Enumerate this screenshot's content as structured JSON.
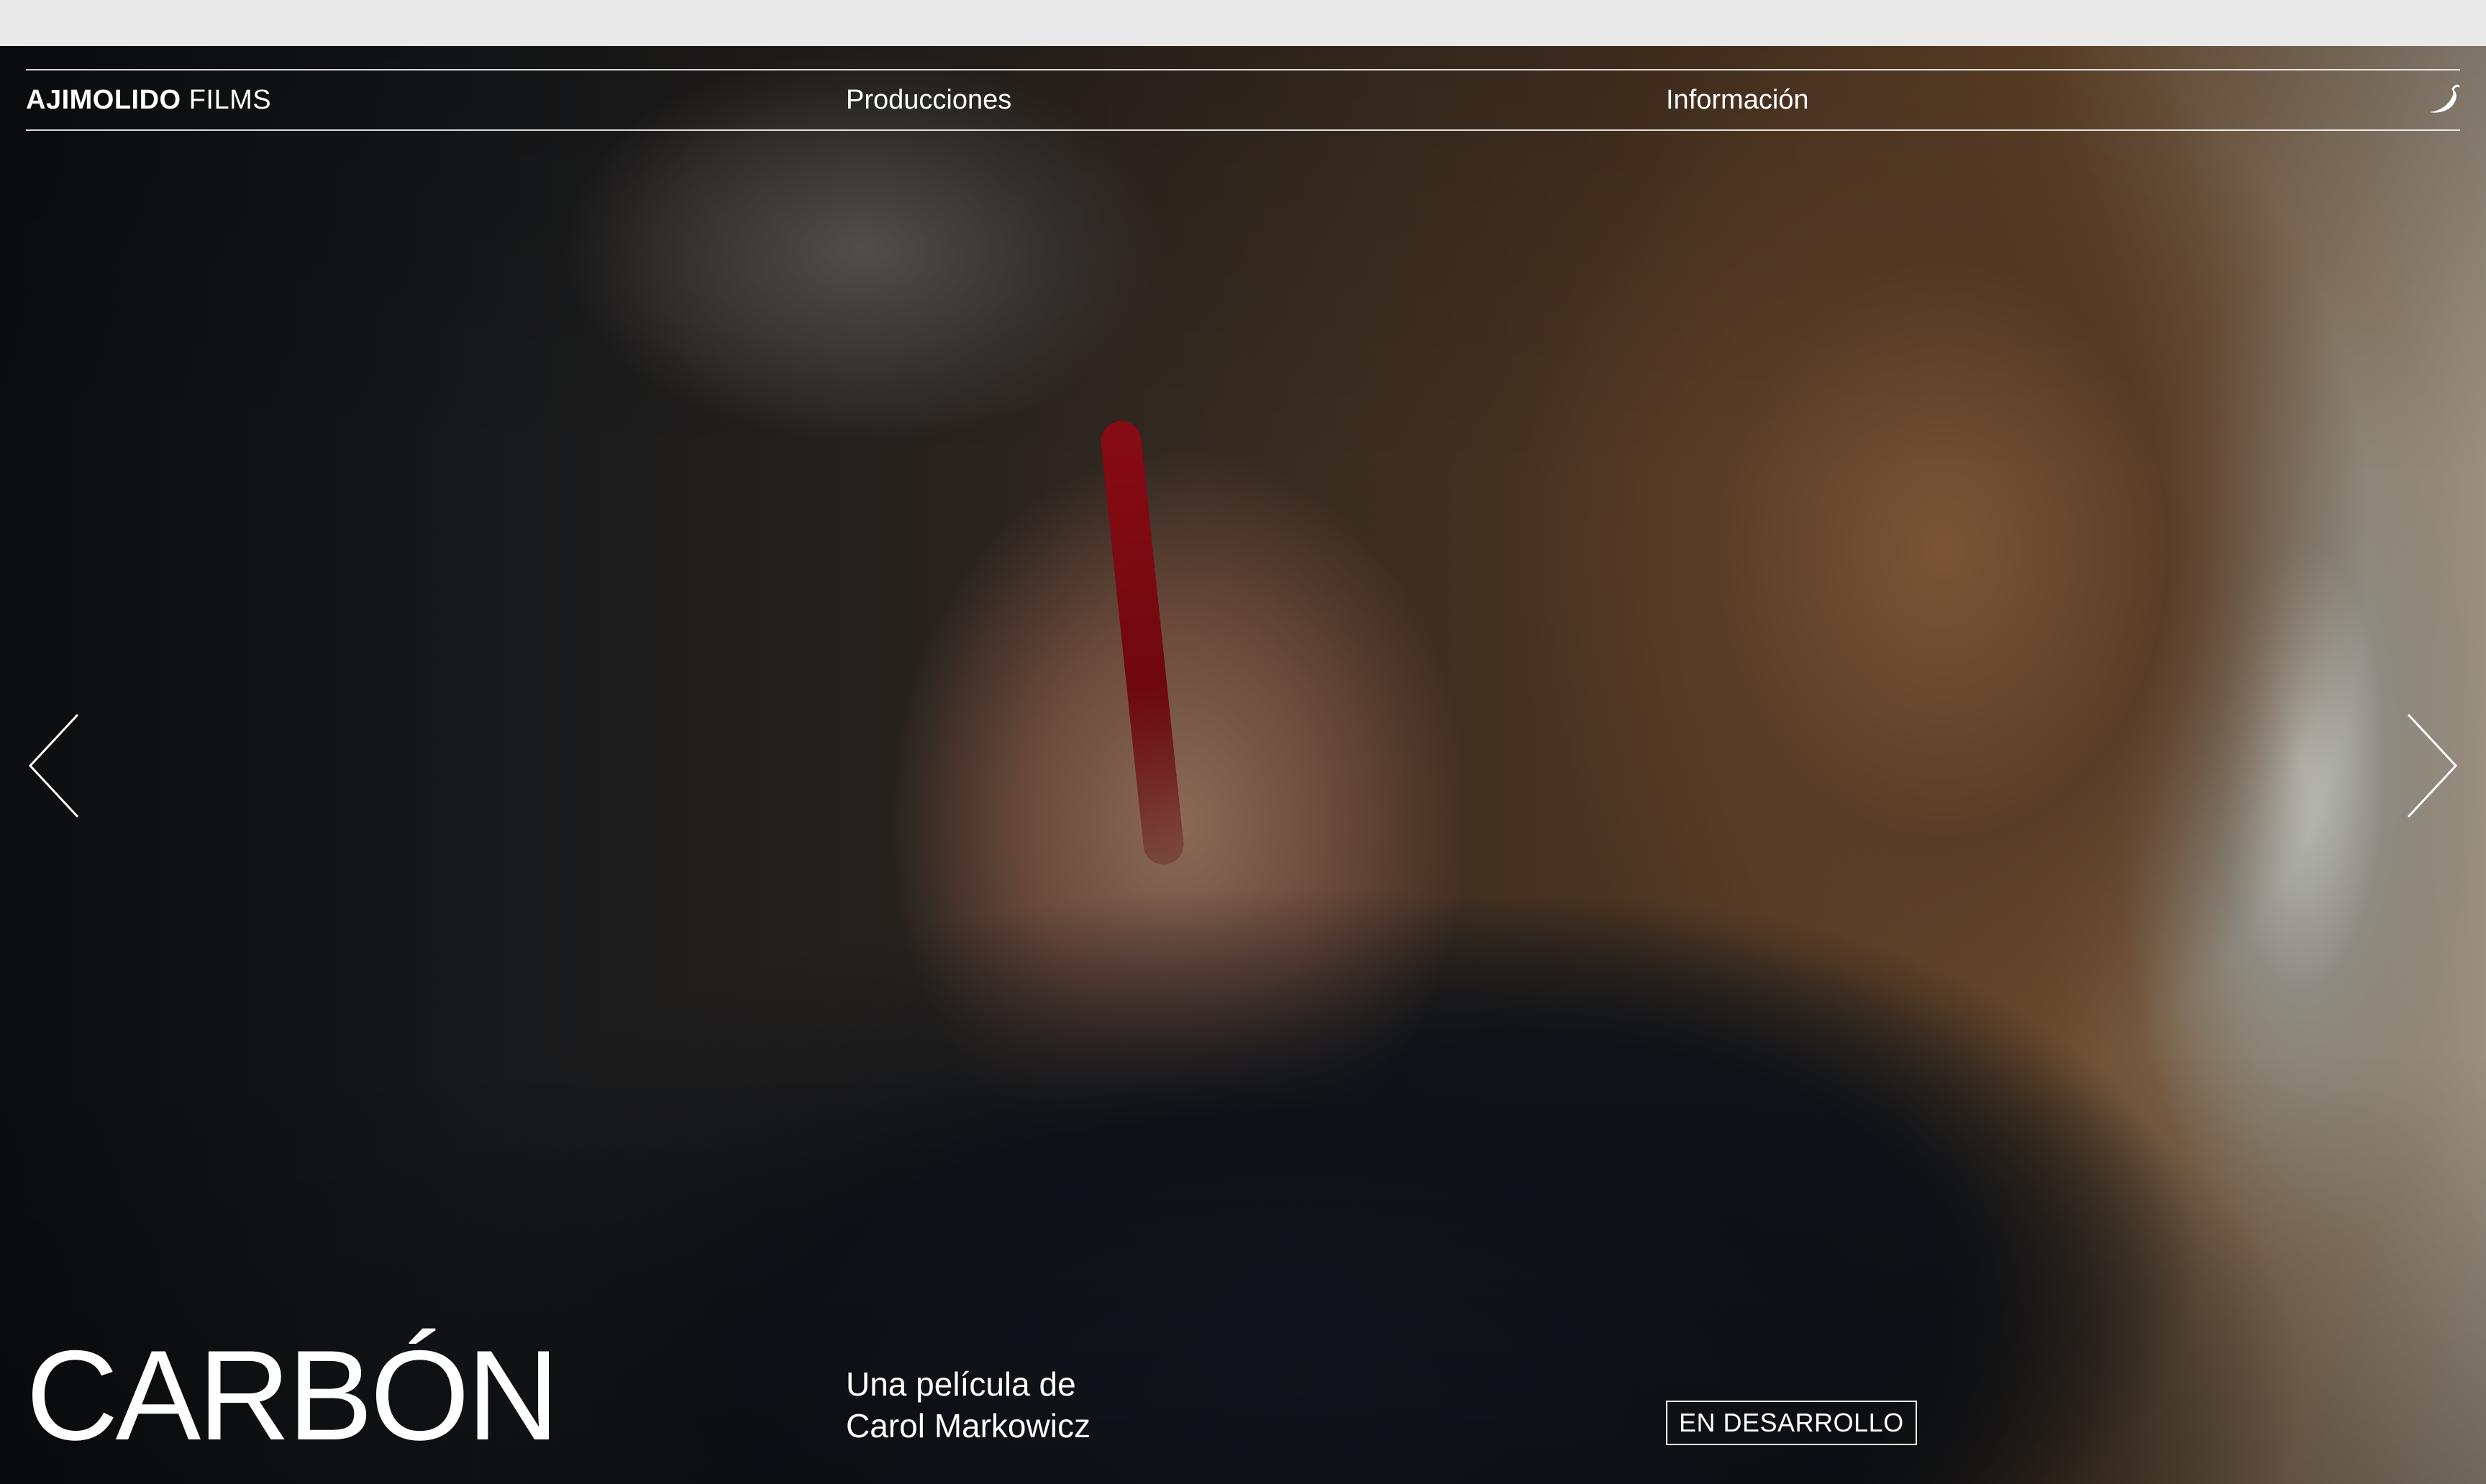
{
  "header": {
    "logo_bold": "AJIMOLIDO",
    "logo_light": "FILMS",
    "nav": [
      {
        "label": "Producciones"
      },
      {
        "label": "Información"
      }
    ],
    "icon": "chili-pepper-icon"
  },
  "carousel": {
    "prev_icon": "chevron-left-icon",
    "next_icon": "chevron-right-icon"
  },
  "film": {
    "title": "CARBÓN",
    "credit_line1": "Una película de",
    "credit_line2": "Carol Markowicz",
    "status": "EN DESARROLLO"
  },
  "colors": {
    "text": "#ffffff",
    "browser_bar": "#e9e9e9"
  }
}
